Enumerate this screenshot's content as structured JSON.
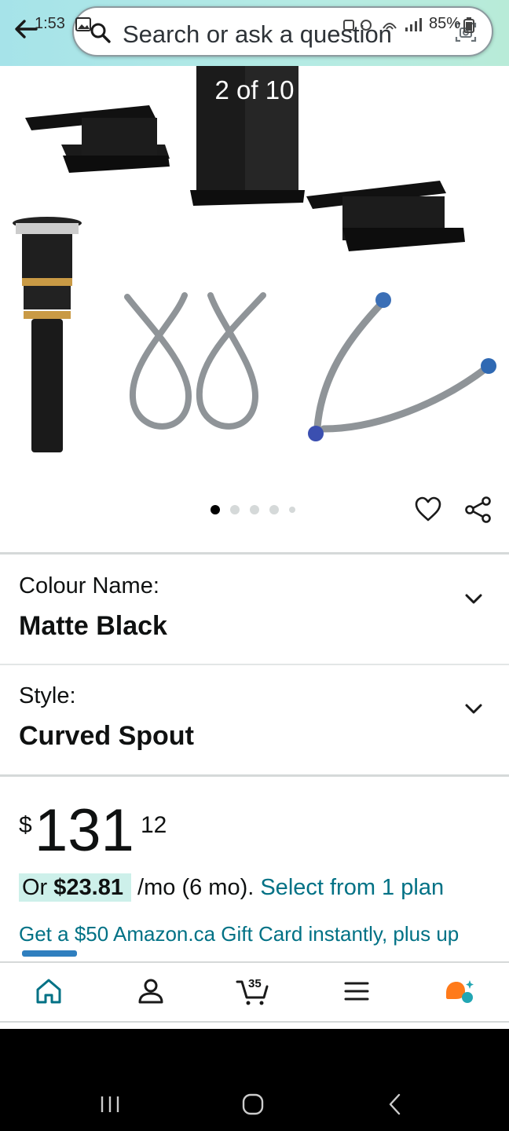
{
  "status_bar": {
    "time": "1:53",
    "battery": "85%"
  },
  "search": {
    "placeholder": "Search or ask a question"
  },
  "gallery": {
    "counter": "2 of 10",
    "dots_total": 5,
    "active_dot": 0
  },
  "variations": [
    {
      "label": "Colour Name:",
      "value": "Matte Black"
    },
    {
      "label": "Style:",
      "value": "Curved Spout"
    }
  ],
  "price": {
    "symbol": "$",
    "whole": "131",
    "fraction": "12"
  },
  "installment": {
    "prefix": "Or ",
    "amount": "$23.81",
    "terms": " /mo (6 mo). ",
    "link": "Select from 1 plan"
  },
  "promo": {
    "gift_card": "Get a $50 Amazon.ca Gift Card instantly, plus up"
  },
  "bottom_nav": {
    "cart_count": "35",
    "items": [
      "home-icon",
      "account-icon",
      "cart-icon",
      "menu-icon",
      "rufus-icon"
    ]
  },
  "colors": {
    "link": "#007185",
    "header_gradient_start": "#a6e3e9",
    "header_gradient_end": "#b8ebd8",
    "installment_highlight": "#cdf0ea",
    "ai_orange": "#ff7a1a",
    "ai_teal": "#22a6b3"
  }
}
